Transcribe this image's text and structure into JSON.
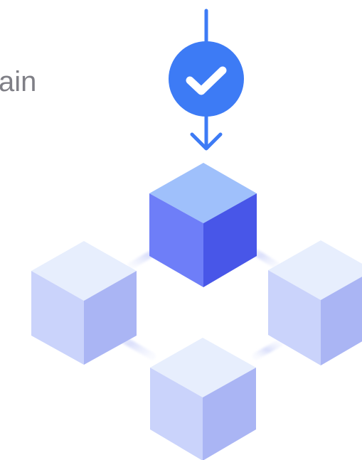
{
  "heading": {
    "visible_text": "ain"
  },
  "illustration": {
    "icons": {
      "top_marker": "checkmark-circle-icon",
      "arrow": "arrow-down-icon",
      "blocks": "cube-icon"
    },
    "colors": {
      "accent_blue": "#3d7bf5",
      "check_white": "#ffffff",
      "active_cube_top": "#9fc0fb",
      "active_cube_left": "#6e7ef8",
      "active_cube_right": "#4856e8",
      "inactive_cube_top": "#e7eefd",
      "inactive_cube_left": "#cad3fb",
      "inactive_cube_right": "#aab5f4",
      "connector": "#dfe3fb",
      "text_gray": "#7f7f86"
    }
  }
}
